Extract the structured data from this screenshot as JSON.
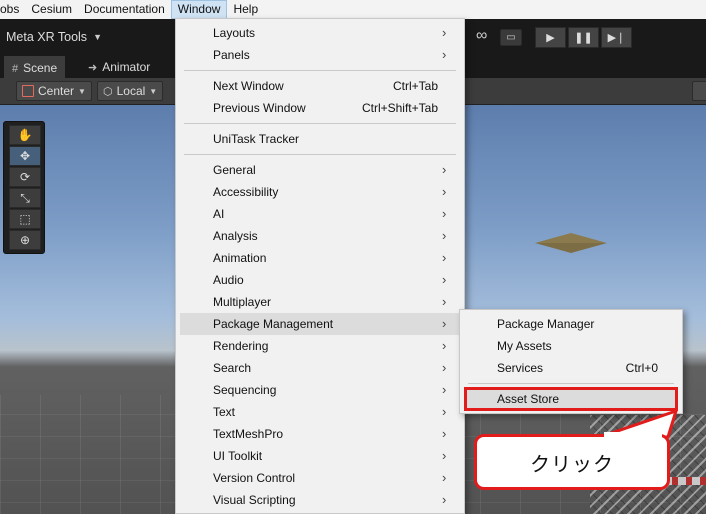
{
  "menubar": {
    "items": [
      "obs",
      "Cesium",
      "Documentation",
      "Window",
      "Help"
    ]
  },
  "toolbar": {
    "meta_xr_label": "Meta XR Tools",
    "play_icon": "play-icon",
    "pause_icon": "pause-icon",
    "step_icon": "step-icon"
  },
  "tabs": [
    {
      "label": "Scene",
      "icon": "hash-icon"
    },
    {
      "label": "Animator",
      "icon": "animator-icon"
    }
  ],
  "scene_toolbar": {
    "pivot_label": "Center",
    "space_label": "Local"
  },
  "window_menu": {
    "items": [
      {
        "label": "Layouts",
        "submenu": true
      },
      {
        "label": "Panels",
        "submenu": true
      },
      {
        "label": "Next Window",
        "shortcut": "Ctrl+Tab"
      },
      {
        "label": "Previous Window",
        "shortcut": "Ctrl+Shift+Tab"
      },
      {
        "label": "UniTask Tracker"
      },
      {
        "label": "General",
        "submenu": true
      },
      {
        "label": "Accessibility",
        "submenu": true
      },
      {
        "label": "AI",
        "submenu": true
      },
      {
        "label": "Analysis",
        "submenu": true
      },
      {
        "label": "Animation",
        "submenu": true
      },
      {
        "label": "Audio",
        "submenu": true
      },
      {
        "label": "Multiplayer",
        "submenu": true
      },
      {
        "label": "Package Management",
        "submenu": true,
        "highlighted": true
      },
      {
        "label": "Rendering",
        "submenu": true
      },
      {
        "label": "Search",
        "submenu": true
      },
      {
        "label": "Sequencing",
        "submenu": true
      },
      {
        "label": "Text",
        "submenu": true
      },
      {
        "label": "TextMeshPro",
        "submenu": true
      },
      {
        "label": "UI Toolkit",
        "submenu": true
      },
      {
        "label": "Version Control",
        "submenu": true
      },
      {
        "label": "Visual Scripting",
        "submenu": true
      }
    ],
    "arrow_glyph": "›"
  },
  "package_submenu": {
    "items": [
      {
        "label": "Package Manager"
      },
      {
        "label": "My Assets"
      },
      {
        "label": "Services",
        "shortcut": "Ctrl+0"
      },
      {
        "label": "Asset Store",
        "highlighted": true
      }
    ]
  },
  "annotation": {
    "callout_text": "クリック",
    "color": "#e21b1b"
  }
}
